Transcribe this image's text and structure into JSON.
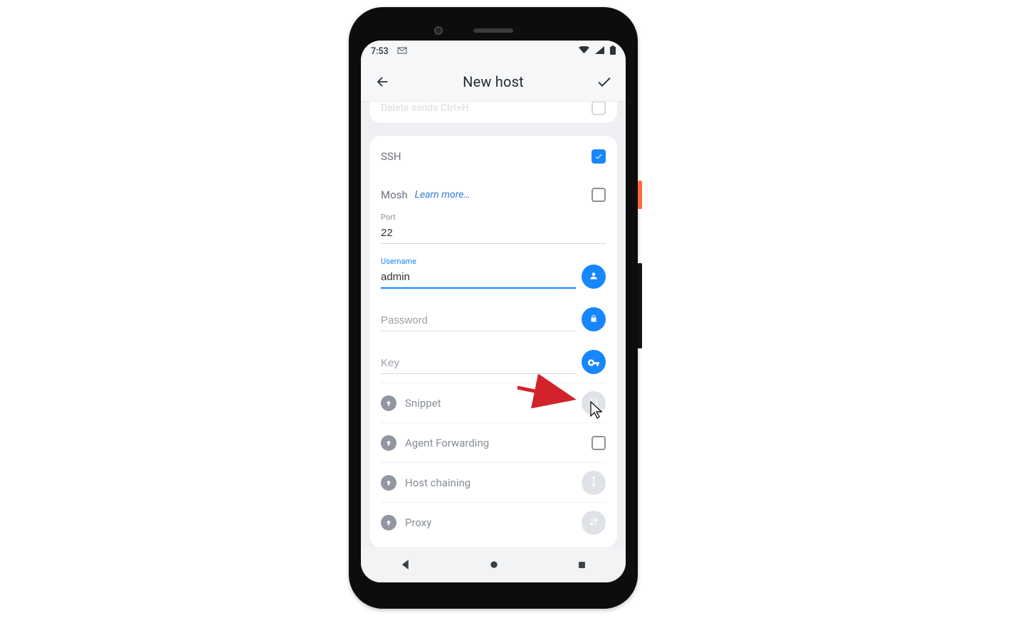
{
  "status_bar": {
    "time": "7:53",
    "left_icon": "gmail-icon",
    "right_icons": "wifi signal battery"
  },
  "app_bar": {
    "title": "New host"
  },
  "prev_card": {
    "cut_label": "Delete sends Ctrl+H"
  },
  "ssh": {
    "label": "SSH",
    "checked": true
  },
  "mosh": {
    "label": "Mosh",
    "learn_more": "Learn more…",
    "checked": false
  },
  "port": {
    "label": "Port",
    "value": "22"
  },
  "username": {
    "label": "Username",
    "value": "admin"
  },
  "password": {
    "placeholder": "Password"
  },
  "key": {
    "placeholder": "Key"
  },
  "rows": {
    "snippet": "Snippet",
    "agent_forwarding": "Agent Forwarding",
    "host_chaining": "Host chaining",
    "proxy": "Proxy"
  }
}
